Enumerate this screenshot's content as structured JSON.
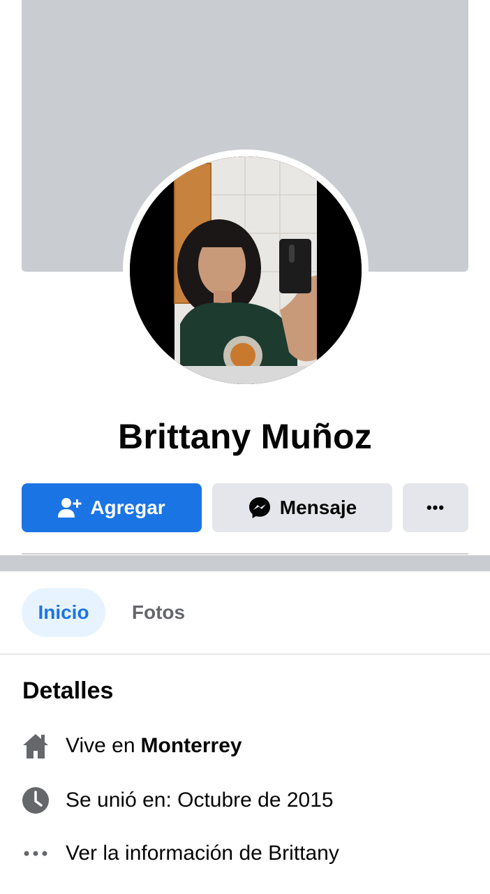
{
  "profile": {
    "name": "Brittany Muñoz"
  },
  "actions": {
    "add_label": "Agregar",
    "message_label": "Mensaje",
    "more_label": "•••"
  },
  "tabs": [
    {
      "label": "Inicio",
      "active": true
    },
    {
      "label": "Fotos",
      "active": false
    }
  ],
  "details": {
    "title": "Detalles",
    "lives_prefix": "Vive en",
    "lives_city": "Monterrey",
    "joined": "Se unió en: Octubre de 2015",
    "more_info": "Ver la información de Brittany"
  },
  "colors": {
    "primary": "#1b74e4",
    "cover": "#c9ccd1",
    "secondary_button": "#e4e6eb",
    "active_tab_bg": "#e7f3ff",
    "muted_text": "#65676b"
  },
  "icons": {
    "add": "add-friend-icon",
    "message": "messenger-icon",
    "more": "more-dots-icon",
    "home": "home-icon",
    "clock": "clock-icon",
    "dots": "dots-icon"
  }
}
